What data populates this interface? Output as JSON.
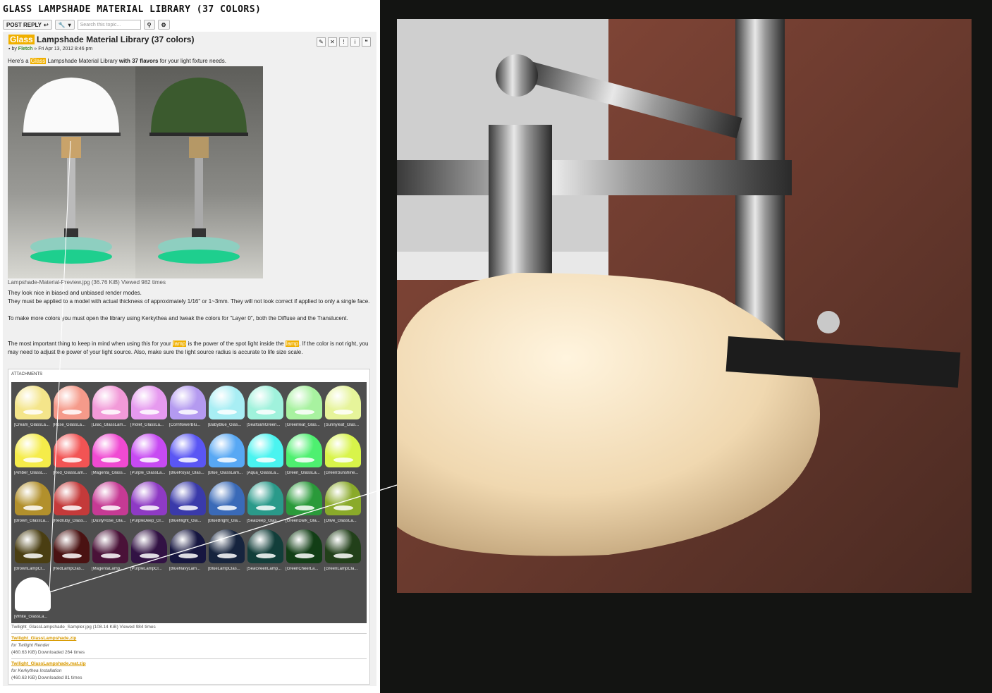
{
  "topic": {
    "title": "GLASS LAMPSHADE MATERIAL LIBRARY (37 COLORS)"
  },
  "actionbar": {
    "post_reply": "POST REPLY",
    "search_placeholder": "Search this topic..."
  },
  "post": {
    "title_highlight": "Glass",
    "title_rest": "Lampshade Material Library (37 colors)",
    "by": "by",
    "author": "Fletch",
    "date": "» Fri Apr 13, 2012 8:46 pm",
    "intro_pre": "Here's a",
    "intro_hl": "Glass",
    "intro_mid": "Lampshade Material Library",
    "intro_bold": "with 37 flavors",
    "intro_post": "for your light fixture needs.",
    "preview_caption": "Lampshade-Material-Preview.jpg (36.76 KiB) Viewed 982 times",
    "p1": "They look nice in biased and unbiased render modes.",
    "p2": "They must be applied to a model with actual thickness of approximately 1/16\" or 1~3mm. They will not look correct if applied to only a single face.",
    "p3": "To make more colors you must open the library using Kerkythea and tweak the colors for \"Layer 0\", both the Diffuse and the Translucent.",
    "p4a": "The most important thing to keep in mind when using this for your",
    "p4_lamp1": "lamp",
    "p4b": "is the power of the spot light inside the",
    "p4_lamp2": "lamp",
    "p4c": ". If the color is not right, you may need to adjust the power of your light source. Also, make sure the light source radius is accurate to life size scale.",
    "attachments_label": "ATTACHMENTS",
    "sampler_caption": "Twilight_GlassLampshade_Sampler.jpg (108.14 KiB) Viewed 984 times",
    "downloads": [
      {
        "file": "Twilight_GlassLampshade.zip",
        "note": "for Twilight Render",
        "meta": "(460.63 KiB) Downloaded 264 times"
      },
      {
        "file": "Twilight_GlassLampshade.mat.zip",
        "note": "for Kerkythea Installation",
        "meta": "(460.63 KiB) Downloaded 81 times"
      }
    ]
  },
  "swatches": [
    {
      "label": "[Cream_GlassLa...",
      "color": "#f4e58a"
    },
    {
      "label": "[Rose_GlassLa...",
      "color": "#f59a8a"
    },
    {
      "label": "[Lilac_GlassLam...",
      "color": "#f29ad8"
    },
    {
      "label": "[Violet_GlassLa...",
      "color": "#e69aef"
    },
    {
      "label": "[CornflowerBlu...",
      "color": "#b49af0"
    },
    {
      "label": "[Babyblue_Glas...",
      "color": "#a8eef4"
    },
    {
      "label": "[SeafoamGreen...",
      "color": "#a0f2dc"
    },
    {
      "label": "[Greenleaf_Glas...",
      "color": "#a8f2a0"
    },
    {
      "label": "[Sunnyleaf_Glas...",
      "color": "#e6f49a"
    },
    {
      "label": "[Amber_GlassL...",
      "color": "#f5ec4a"
    },
    {
      "label": "[Red_GlassLam...",
      "color": "#f25454"
    },
    {
      "label": "[Magenta_Glass...",
      "color": "#f04ad2"
    },
    {
      "label": "[Purple_GlassLa...",
      "color": "#c74af2"
    },
    {
      "label": "[BlueRoyal_Glas...",
      "color": "#5a56f4"
    },
    {
      "label": "[Blue_GlassLam...",
      "color": "#58a8f4"
    },
    {
      "label": "[Aqua_GlassLa...",
      "color": "#4af4f0"
    },
    {
      "label": "[Green_GlassLa...",
      "color": "#4ef070"
    },
    {
      "label": "[GreenSunshine...",
      "color": "#d8f44a"
    },
    {
      "label": "[Brown_GlassLa...",
      "color": "#b2902c"
    },
    {
      "label": "[Redruby_Glass...",
      "color": "#c43a3a"
    },
    {
      "label": "[DustyRose_Gla...",
      "color": "#c63a94"
    },
    {
      "label": "[PurpleDeep_Gl...",
      "color": "#8e3ac4"
    },
    {
      "label": "[BlueNight_Gla...",
      "color": "#3a3aaa"
    },
    {
      "label": "[BlueBright_Gla...",
      "color": "#3a6ab8"
    },
    {
      "label": "[SeaDeep_Glas...",
      "color": "#2a9a8a"
    },
    {
      "label": "[GreenDark_Gla...",
      "color": "#2a9a3a"
    },
    {
      "label": "[Olive_GlassLa...",
      "color": "#8aaa2a"
    },
    {
      "label": "[BrownLampCl...",
      "color": "#4a3e12"
    },
    {
      "label": "[RedLampClas...",
      "color": "#4a1212"
    },
    {
      "label": "[MagentaLamp...",
      "color": "#4a1238"
    },
    {
      "label": "[PurpleLampCl...",
      "color": "#321244"
    },
    {
      "label": "[BlueNavyLam...",
      "color": "#161640"
    },
    {
      "label": "[BlueLampClas...",
      "color": "#16243e"
    },
    {
      "label": "[SeaGreenLamp...",
      "color": "#123e3a"
    },
    {
      "label": "[GreenCheerLa...",
      "color": "#123e16"
    },
    {
      "label": "[GreenLampCla...",
      "color": "#22401a"
    },
    {
      "label": "[White_GlassLa...",
      "color": "#ffffff"
    }
  ]
}
